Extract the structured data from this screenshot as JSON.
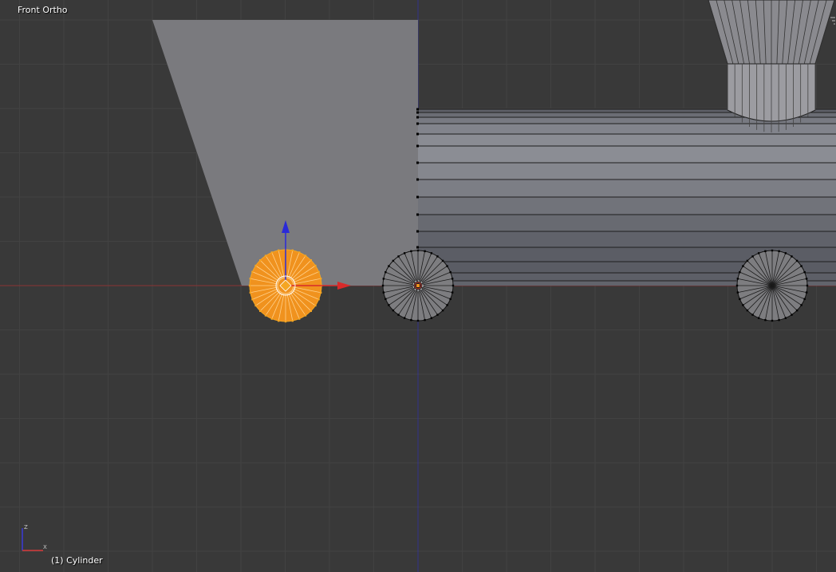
{
  "viewport": {
    "view_name": "Front Ortho",
    "active_object": "(1) Cylinder"
  },
  "axis_gizmo": {
    "vertical_axis": "Z",
    "horizontal_axis": "X"
  },
  "icons": {
    "corner_widget": "area-split-corner-icon",
    "transform_manipulator": "translate-manipulator-icon",
    "axis_orientation": "axis-orientation-icon"
  },
  "colors": {
    "background": "#393939",
    "grid": "#424242",
    "x_axis": "#a23b3b",
    "z_axis": "#3b3ba2",
    "selection": "#f0921e",
    "selection_edge": "#f5a623"
  }
}
